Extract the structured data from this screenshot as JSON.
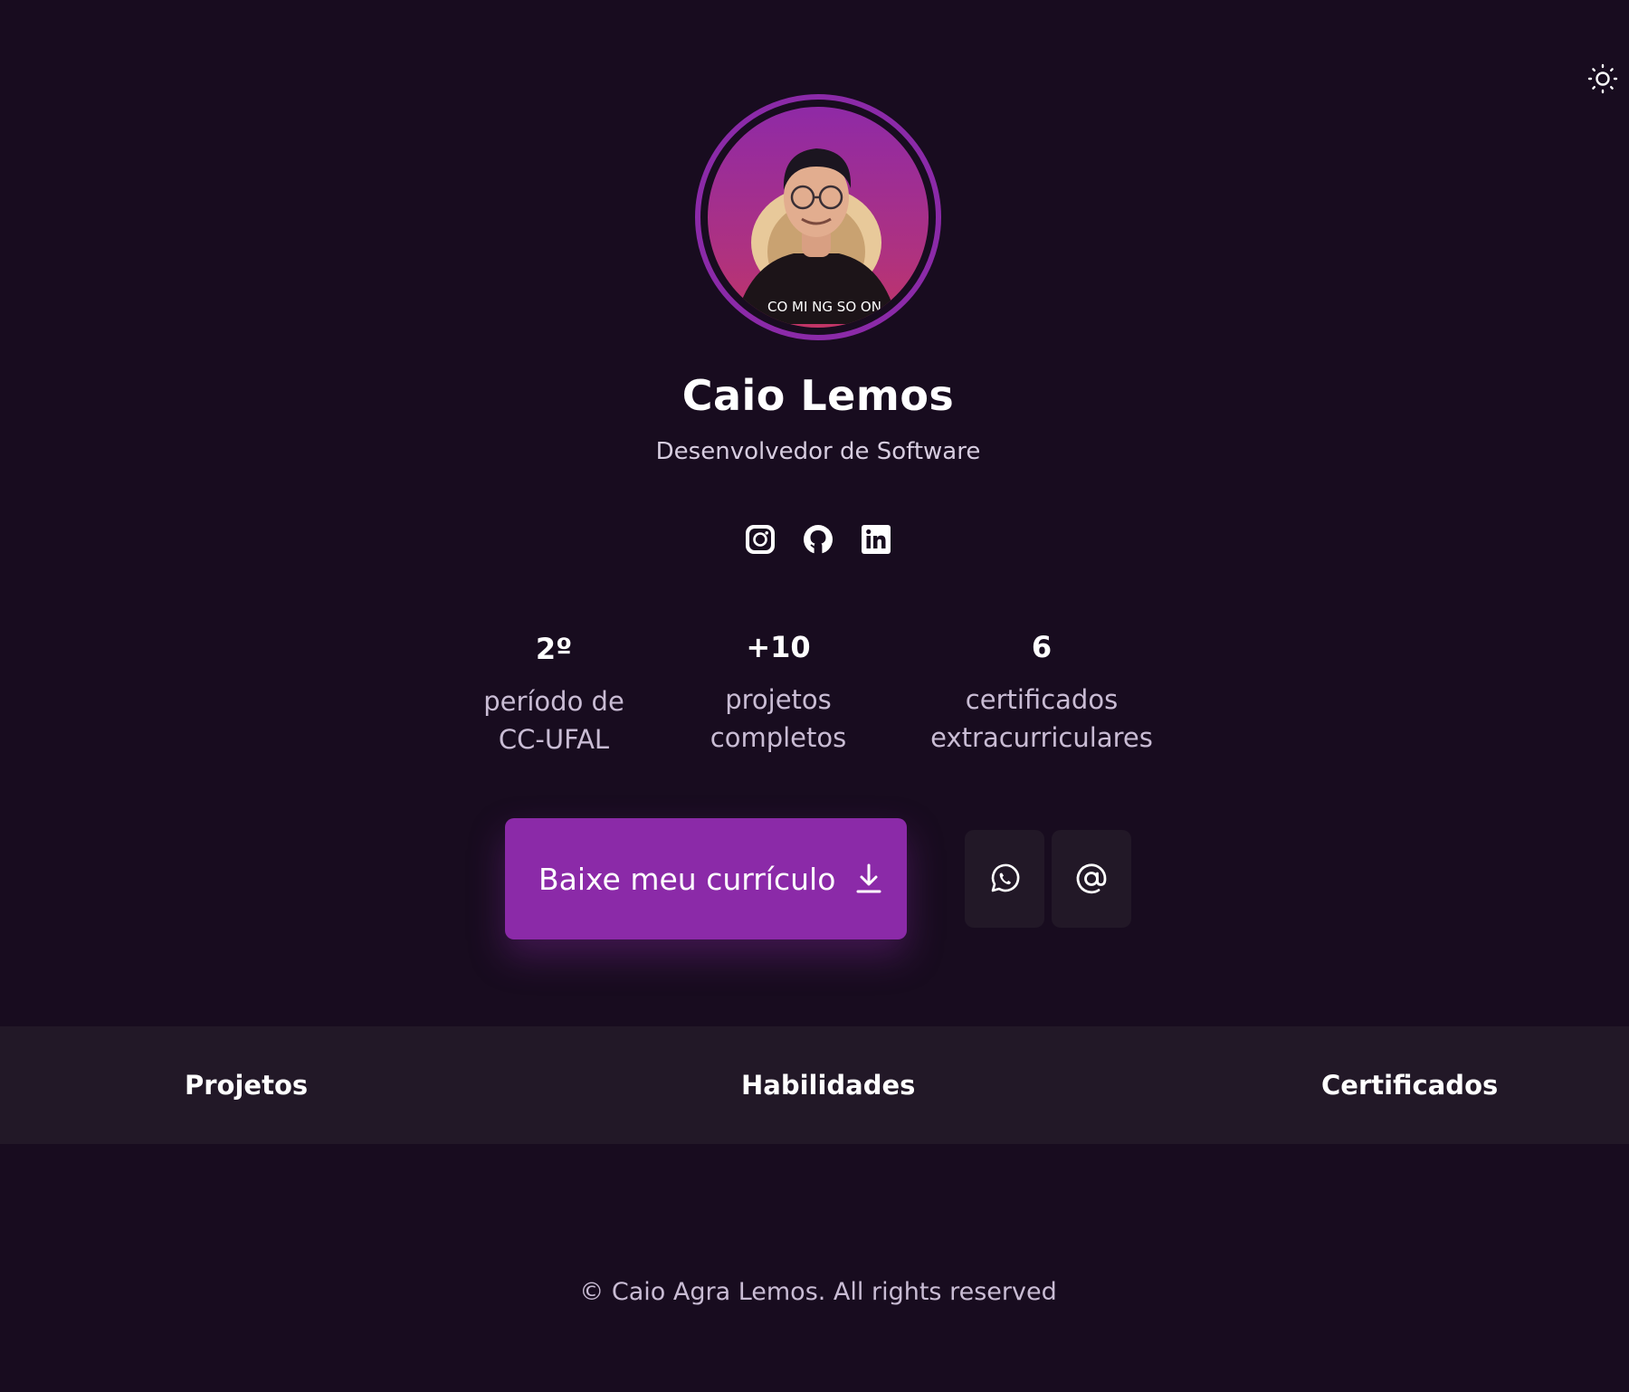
{
  "theme_toggle": {
    "icon": "sun-icon"
  },
  "profile": {
    "name": "Caio Lemos",
    "role": "Desenvolvedor de Software",
    "avatar_gradient": [
      "#8f2aa6",
      "#c23566"
    ],
    "shirt_text": "CO MI NG SO ON"
  },
  "socials": [
    {
      "name": "instagram",
      "icon": "instagram-icon"
    },
    {
      "name": "github",
      "icon": "github-icon"
    },
    {
      "name": "linkedin",
      "icon": "linkedin-icon"
    }
  ],
  "stats": [
    {
      "value": "2º",
      "label_line1": "período de",
      "label_line2": "CC-UFAL"
    },
    {
      "value": "+10",
      "label_line1": "projetos",
      "label_line2": "completos"
    },
    {
      "value": "6",
      "label_line1": "certificados",
      "label_line2": "extracurriculares"
    }
  ],
  "cta": {
    "label": "Baixe meu currículo",
    "icon": "download-icon"
  },
  "contact_buttons": [
    {
      "name": "whatsapp",
      "icon": "whatsapp-icon"
    },
    {
      "name": "email",
      "icon": "at-sign-icon"
    }
  ],
  "nav": {
    "items": [
      "Projetos",
      "Habilidades",
      "Certificados"
    ]
  },
  "footer": {
    "text": "© Caio Agra Lemos. All rights reserved"
  },
  "colors": {
    "background": "#180c1f",
    "accent": "#8b2aa8",
    "panel": "#221827",
    "muted_text": "#c9bcd4"
  }
}
